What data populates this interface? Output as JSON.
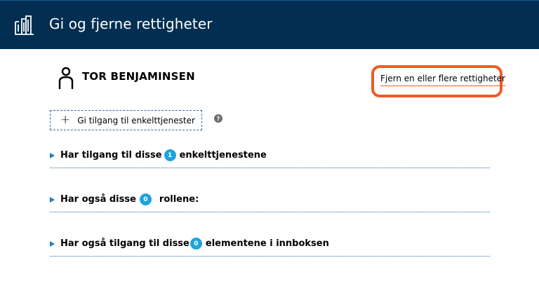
{
  "header": {
    "title": "Gi og fjerne rettigheter",
    "logo_icon": "building-icon",
    "background": "#022f51"
  },
  "user": {
    "name": "TOR BENJAMINSEN",
    "icon": "person-icon"
  },
  "actions": {
    "remove_link": "Fjern en eller flere rettigheter",
    "highlight_color": "#f15a24",
    "add_button": "Gi tilgang til enkelttjenester",
    "add_icon": "plus-icon",
    "help_icon": "?"
  },
  "sections": [
    {
      "before": "Har tilgang til disse",
      "count": "1",
      "after": "enkelttjenestene"
    },
    {
      "before": "Har også disse",
      "count": "0",
      "after": "rollene:"
    },
    {
      "before": "Har også tilgang til disse",
      "count": "0",
      "after": "elementene i innboksen"
    }
  ],
  "colors": {
    "accent": "#1e7bc4",
    "badge": "#1ea4dd"
  }
}
